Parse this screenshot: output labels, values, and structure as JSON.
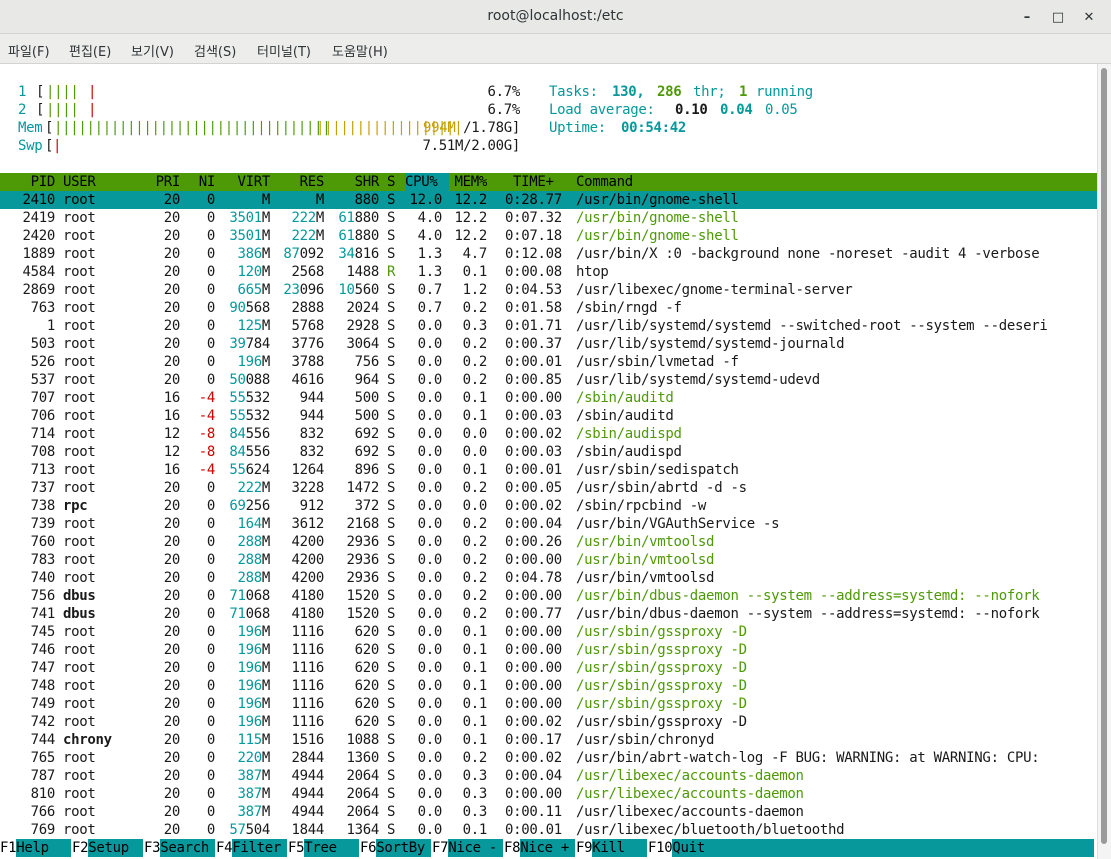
{
  "window": {
    "title": "root@localhost:/etc"
  },
  "menu": [
    "파일(F)",
    "편집(E)",
    "보기(V)",
    "검색(S)",
    "터미널(T)",
    "도움말(H)"
  ],
  "meters": {
    "cpu1": {
      "label": "1",
      "bars": "||||",
      "value": "6.7%"
    },
    "cpu2": {
      "label": "2",
      "bars": "||||",
      "value": "6.7%"
    },
    "mem": {
      "label": "Mem",
      "bars_green": "||||||||||||||||||||||||||||||||||",
      "bars_yellow": "||||||||||||||||||",
      "value": "994M/1.78G"
    },
    "swp": {
      "label": "Swp",
      "bars": "|",
      "value": "7.51M/2.00G"
    }
  },
  "stats": {
    "tasks_label": "Tasks:",
    "tasks": "130,",
    "thr": "286",
    "thr_label": "thr;",
    "running": "1",
    "running_label": "running",
    "load_label": "Load average:",
    "load1": "0.10",
    "load5": "0.04",
    "load15": "0.05",
    "uptime_label": "Uptime:",
    "uptime": "00:54:42"
  },
  "columns": [
    "PID",
    "USER",
    "PRI",
    "NI",
    "VIRT",
    "RES",
    "SHR",
    "S",
    "CPU%",
    "MEM%",
    "TIME+",
    "Command"
  ],
  "rows": [
    [
      "2410",
      "root",
      "20",
      "0",
      "3501M",
      "222M",
      "61880",
      "S",
      "12.0",
      "12.2",
      "0:28.77",
      "/usr/bin/gnome-shell"
    ],
    [
      "2419",
      "root",
      "20",
      "0",
      "3501M",
      "222M",
      "61880",
      "S",
      "4.0",
      "12.2",
      "0:07.32",
      "/usr/bin/gnome-shell"
    ],
    [
      "2420",
      "root",
      "20",
      "0",
      "3501M",
      "222M",
      "61880",
      "S",
      "4.0",
      "12.2",
      "0:07.18",
      "/usr/bin/gnome-shell"
    ],
    [
      "1889",
      "root",
      "20",
      "0",
      "386M",
      "87092",
      "34816",
      "S",
      "1.3",
      "4.7",
      "0:12.08",
      "/usr/bin/X :0 -background none -noreset -audit 4 -verbose"
    ],
    [
      "4584",
      "root",
      "20",
      "0",
      "120M",
      "2568",
      "1488",
      "R",
      "1.3",
      "0.1",
      "0:00.08",
      "htop"
    ],
    [
      "2869",
      "root",
      "20",
      "0",
      "665M",
      "23096",
      "10560",
      "S",
      "0.7",
      "1.2",
      "0:04.53",
      "/usr/libexec/gnome-terminal-server"
    ],
    [
      "763",
      "root",
      "20",
      "0",
      "90568",
      "2888",
      "2024",
      "S",
      "0.7",
      "0.2",
      "0:01.58",
      "/sbin/rngd -f"
    ],
    [
      "1",
      "root",
      "20",
      "0",
      "125M",
      "5768",
      "2928",
      "S",
      "0.0",
      "0.3",
      "0:01.71",
      "/usr/lib/systemd/systemd --switched-root --system --deseri"
    ],
    [
      "503",
      "root",
      "20",
      "0",
      "39784",
      "3776",
      "3064",
      "S",
      "0.0",
      "0.2",
      "0:00.37",
      "/usr/lib/systemd/systemd-journald"
    ],
    [
      "526",
      "root",
      "20",
      "0",
      "196M",
      "3788",
      "756",
      "S",
      "0.0",
      "0.2",
      "0:00.01",
      "/usr/sbin/lvmetad -f"
    ],
    [
      "537",
      "root",
      "20",
      "0",
      "50088",
      "4616",
      "964",
      "S",
      "0.0",
      "0.2",
      "0:00.85",
      "/usr/lib/systemd/systemd-udevd"
    ],
    [
      "707",
      "root",
      "16",
      "-4",
      "55532",
      "944",
      "500",
      "S",
      "0.0",
      "0.1",
      "0:00.00",
      "/sbin/auditd"
    ],
    [
      "706",
      "root",
      "16",
      "-4",
      "55532",
      "944",
      "500",
      "S",
      "0.0",
      "0.1",
      "0:00.03",
      "/sbin/auditd"
    ],
    [
      "714",
      "root",
      "12",
      "-8",
      "84556",
      "832",
      "692",
      "S",
      "0.0",
      "0.0",
      "0:00.02",
      "/sbin/audispd"
    ],
    [
      "708",
      "root",
      "12",
      "-8",
      "84556",
      "832",
      "692",
      "S",
      "0.0",
      "0.0",
      "0:00.03",
      "/sbin/audispd"
    ],
    [
      "713",
      "root",
      "16",
      "-4",
      "55624",
      "1264",
      "896",
      "S",
      "0.0",
      "0.1",
      "0:00.01",
      "/usr/sbin/sedispatch"
    ],
    [
      "737",
      "root",
      "20",
      "0",
      "222M",
      "3228",
      "1472",
      "S",
      "0.0",
      "0.2",
      "0:00.05",
      "/usr/sbin/abrtd -d -s"
    ],
    [
      "738",
      "rpc",
      "20",
      "0",
      "69256",
      "912",
      "372",
      "S",
      "0.0",
      "0.0",
      "0:00.02",
      "/sbin/rpcbind -w"
    ],
    [
      "739",
      "root",
      "20",
      "0",
      "164M",
      "3612",
      "2168",
      "S",
      "0.0",
      "0.2",
      "0:00.04",
      "/usr/bin/VGAuthService -s"
    ],
    [
      "760",
      "root",
      "20",
      "0",
      "288M",
      "4200",
      "2936",
      "S",
      "0.0",
      "0.2",
      "0:00.26",
      "/usr/bin/vmtoolsd"
    ],
    [
      "783",
      "root",
      "20",
      "0",
      "288M",
      "4200",
      "2936",
      "S",
      "0.0",
      "0.2",
      "0:00.00",
      "/usr/bin/vmtoolsd"
    ],
    [
      "740",
      "root",
      "20",
      "0",
      "288M",
      "4200",
      "2936",
      "S",
      "0.0",
      "0.2",
      "0:04.78",
      "/usr/bin/vmtoolsd"
    ],
    [
      "756",
      "dbus",
      "20",
      "0",
      "71068",
      "4180",
      "1520",
      "S",
      "0.0",
      "0.2",
      "0:00.00",
      "/usr/bin/dbus-daemon --system --address=systemd: --nofork"
    ],
    [
      "741",
      "dbus",
      "20",
      "0",
      "71068",
      "4180",
      "1520",
      "S",
      "0.0",
      "0.2",
      "0:00.77",
      "/usr/bin/dbus-daemon --system --address=systemd: --nofork"
    ],
    [
      "745",
      "root",
      "20",
      "0",
      "196M",
      "1116",
      "620",
      "S",
      "0.0",
      "0.1",
      "0:00.00",
      "/usr/sbin/gssproxy -D"
    ],
    [
      "746",
      "root",
      "20",
      "0",
      "196M",
      "1116",
      "620",
      "S",
      "0.0",
      "0.1",
      "0:00.00",
      "/usr/sbin/gssproxy -D"
    ],
    [
      "747",
      "root",
      "20",
      "0",
      "196M",
      "1116",
      "620",
      "S",
      "0.0",
      "0.1",
      "0:00.00",
      "/usr/sbin/gssproxy -D"
    ],
    [
      "748",
      "root",
      "20",
      "0",
      "196M",
      "1116",
      "620",
      "S",
      "0.0",
      "0.1",
      "0:00.00",
      "/usr/sbin/gssproxy -D"
    ],
    [
      "749",
      "root",
      "20",
      "0",
      "196M",
      "1116",
      "620",
      "S",
      "0.0",
      "0.1",
      "0:00.00",
      "/usr/sbin/gssproxy -D"
    ],
    [
      "742",
      "root",
      "20",
      "0",
      "196M",
      "1116",
      "620",
      "S",
      "0.0",
      "0.1",
      "0:00.02",
      "/usr/sbin/gssproxy -D"
    ],
    [
      "744",
      "chrony",
      "20",
      "0",
      "115M",
      "1516",
      "1088",
      "S",
      "0.0",
      "0.1",
      "0:00.17",
      "/usr/sbin/chronyd"
    ],
    [
      "765",
      "root",
      "20",
      "0",
      "220M",
      "2844",
      "1360",
      "S",
      "0.0",
      "0.2",
      "0:00.02",
      "/usr/bin/abrt-watch-log -F BUG: WARNING: at WARNING: CPU:"
    ],
    [
      "787",
      "root",
      "20",
      "0",
      "387M",
      "4944",
      "2064",
      "S",
      "0.0",
      "0.3",
      "0:00.04",
      "/usr/libexec/accounts-daemon"
    ],
    [
      "810",
      "root",
      "20",
      "0",
      "387M",
      "4944",
      "2064",
      "S",
      "0.0",
      "0.3",
      "0:00.00",
      "/usr/libexec/accounts-daemon"
    ],
    [
      "766",
      "root",
      "20",
      "0",
      "387M",
      "4944",
      "2064",
      "S",
      "0.0",
      "0.3",
      "0:00.11",
      "/usr/libexec/accounts-daemon"
    ],
    [
      "769",
      "root",
      "20",
      "0",
      "57504",
      "1844",
      "1364",
      "S",
      "0.0",
      "0.1",
      "0:00.01",
      "/usr/libexec/bluetooth/bluetoothd"
    ]
  ],
  "thread_rows": [
    1,
    2,
    11,
    13,
    19,
    20,
    22,
    24,
    25,
    26,
    27,
    28,
    32,
    33
  ],
  "bold_users": [
    "dbus",
    "rpc",
    "chrony"
  ],
  "fkeys": [
    [
      "F1",
      "Help"
    ],
    [
      "F2",
      "Setup"
    ],
    [
      "F3",
      "Search"
    ],
    [
      "F4",
      "Filter"
    ],
    [
      "F5",
      "Tree"
    ],
    [
      "F6",
      "SortBy"
    ],
    [
      "F7",
      "Nice -"
    ],
    [
      "F8",
      "Nice +"
    ],
    [
      "F9",
      "Kill"
    ],
    [
      "F10",
      "Quit"
    ]
  ]
}
